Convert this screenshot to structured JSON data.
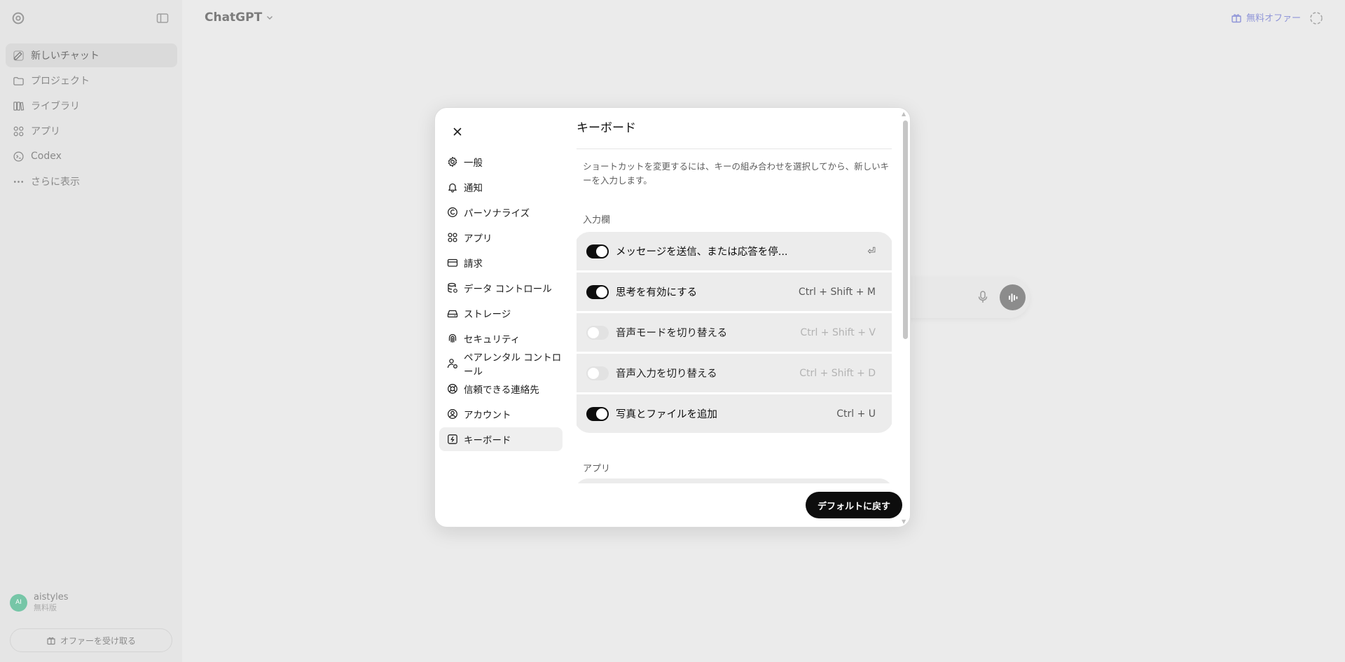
{
  "sidebar": {
    "items": [
      {
        "label": "新しいチャット",
        "icon": "edit-icon"
      },
      {
        "label": "プロジェクト",
        "icon": "folder-icon"
      },
      {
        "label": "ライブラリ",
        "icon": "library-icon"
      },
      {
        "label": "アプリ",
        "icon": "apps-icon"
      },
      {
        "label": "Codex",
        "icon": "codex-icon"
      },
      {
        "label": "さらに表示",
        "icon": "more-icon"
      }
    ],
    "user": {
      "initials": "AI",
      "name": "aistyles",
      "plan": "無料版"
    },
    "offer_button": "オファーを受け取る"
  },
  "header": {
    "model": "ChatGPT",
    "free_offer": "無料オファー"
  },
  "modal": {
    "nav": [
      {
        "label": "一般",
        "icon": "gear-icon"
      },
      {
        "label": "通知",
        "icon": "bell-icon"
      },
      {
        "label": "パーソナライズ",
        "icon": "personalize-icon"
      },
      {
        "label": "アプリ",
        "icon": "apps-icon"
      },
      {
        "label": "請求",
        "icon": "credit-card-icon"
      },
      {
        "label": "データ コントロール",
        "icon": "database-icon"
      },
      {
        "label": "ストレージ",
        "icon": "storage-icon"
      },
      {
        "label": "セキュリティ",
        "icon": "fingerprint-icon"
      },
      {
        "label": "ペアレンタル コントロール",
        "icon": "parental-icon"
      },
      {
        "label": "信頼できる連絡先",
        "icon": "lifebuoy-icon"
      },
      {
        "label": "アカウント",
        "icon": "account-icon"
      },
      {
        "label": "キーボード",
        "icon": "keyboard-icon"
      }
    ],
    "active_nav": "キーボード",
    "title": "キーボード",
    "description": "ショートカットを変更するには、キーの組み合わせを選択してから、新しいキーを入力します。",
    "sections": [
      {
        "label": "入力欄",
        "shortcuts": [
          {
            "label": "メッセージを送信、または応答を停...",
            "keys": "⏎",
            "enabled": true
          },
          {
            "label": "思考を有効にする",
            "keys": "Ctrl + Shift + M",
            "enabled": true
          },
          {
            "label": "音声モードを切り替える",
            "keys": "Ctrl + Shift + V",
            "enabled": false
          },
          {
            "label": "音声入力を切り替える",
            "keys": "Ctrl + Shift + D",
            "enabled": false
          },
          {
            "label": "写真とファイルを追加",
            "keys": "Ctrl + U",
            "enabled": true
          }
        ]
      },
      {
        "label": "アプリ",
        "shortcuts": []
      }
    ],
    "reset_button": "デフォルトに戻す"
  }
}
